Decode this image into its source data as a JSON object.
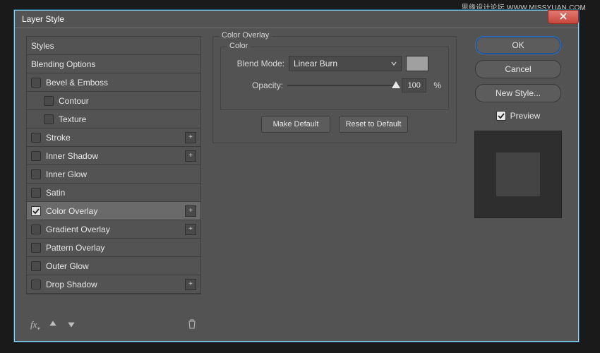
{
  "watermark": "思缘设计论坛  WWW.MISSYUAN.COM",
  "titlebar": {
    "title": "Layer Style"
  },
  "left": {
    "styles_label": "Styles",
    "blending_label": "Blending Options",
    "items": [
      {
        "label": "Bevel & Emboss",
        "checked": false,
        "plus": false,
        "indent": 0
      },
      {
        "label": "Contour",
        "checked": false,
        "plus": false,
        "indent": 1
      },
      {
        "label": "Texture",
        "checked": false,
        "plus": false,
        "indent": 1
      },
      {
        "label": "Stroke",
        "checked": false,
        "plus": true,
        "indent": 0
      },
      {
        "label": "Inner Shadow",
        "checked": false,
        "plus": true,
        "indent": 0
      },
      {
        "label": "Inner Glow",
        "checked": false,
        "plus": false,
        "indent": 0
      },
      {
        "label": "Satin",
        "checked": false,
        "plus": false,
        "indent": 0
      },
      {
        "label": "Color Overlay",
        "checked": true,
        "plus": true,
        "indent": 0,
        "selected": true
      },
      {
        "label": "Gradient Overlay",
        "checked": false,
        "plus": true,
        "indent": 0
      },
      {
        "label": "Pattern Overlay",
        "checked": false,
        "plus": false,
        "indent": 0
      },
      {
        "label": "Outer Glow",
        "checked": false,
        "plus": false,
        "indent": 0
      },
      {
        "label": "Drop Shadow",
        "checked": false,
        "plus": true,
        "indent": 0
      }
    ],
    "fx_label": "fx"
  },
  "middle": {
    "group_title": "Color Overlay",
    "color_title": "Color",
    "blend_mode_label": "Blend Mode:",
    "blend_mode_value": "Linear Burn",
    "opacity_label": "Opacity:",
    "opacity_value": "100",
    "opacity_unit": "%",
    "make_default": "Make Default",
    "reset_default": "Reset to Default",
    "swatch_color": "#a0a0a0"
  },
  "right": {
    "ok": "OK",
    "cancel": "Cancel",
    "new_style": "New Style...",
    "preview_label": "Preview",
    "preview_checked": true
  }
}
